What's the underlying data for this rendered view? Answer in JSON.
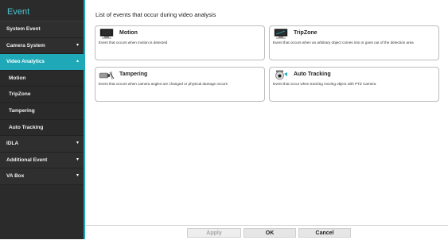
{
  "sidebar": {
    "title": "Event",
    "items": [
      {
        "label": "System Event",
        "arrow": ""
      },
      {
        "label": "Camera System",
        "arrow": "▾"
      },
      {
        "label": "Video Analytics",
        "arrow": "▴"
      },
      {
        "label": "Motion",
        "arrow": ""
      },
      {
        "label": "TripZone",
        "arrow": ""
      },
      {
        "label": "Tampering",
        "arrow": ""
      },
      {
        "label": "Auto Tracking",
        "arrow": ""
      },
      {
        "label": "IDLA",
        "arrow": "▾"
      },
      {
        "label": "Additional Event",
        "arrow": "▾"
      },
      {
        "label": "VA Box",
        "arrow": "▾"
      }
    ]
  },
  "main": {
    "heading": "List of events that occur during video analysis",
    "cards": [
      {
        "title": "Motion",
        "desc": "Event that occurs when motion is detected",
        "icon": "monitor-motion-icon"
      },
      {
        "title": "TripZone",
        "desc": "Event that occurs when an arbitrary object comes into or goes out of the detection area",
        "icon": "monitor-tripzone-icon"
      },
      {
        "title": "Tampering",
        "desc": "Event that occurs when camera angles are changed or physical damage occurs",
        "icon": "camera-tampering-icon"
      },
      {
        "title": "Auto Tracking",
        "desc": "Event that occur when tracking moving object with PTZ Camera",
        "icon": "ptz-camera-icon"
      }
    ]
  },
  "footer": {
    "apply_label": "Apply",
    "ok_label": "OK",
    "cancel_label": "Cancel"
  }
}
